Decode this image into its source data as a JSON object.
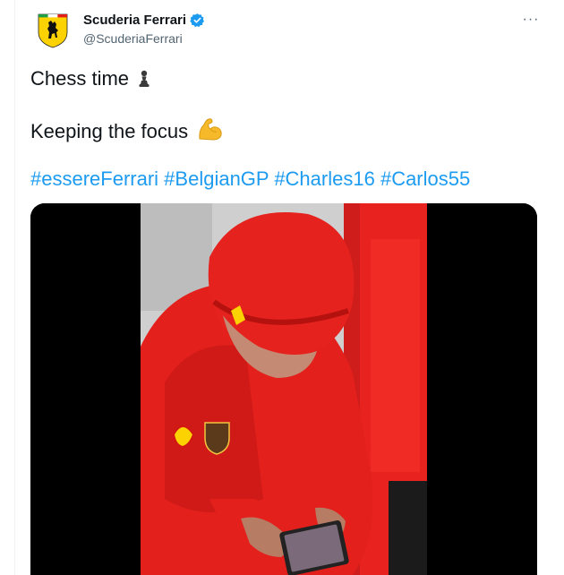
{
  "account": {
    "display_name": "Scuderia Ferrari",
    "handle": "@ScuderiaFerrari",
    "verified": true,
    "avatar_icon": "ferrari-shield-logo"
  },
  "menu": {
    "more_label": "···"
  },
  "tweet": {
    "line1": "Chess time",
    "line1_emoji": "chess-pawn",
    "line2": "Keeping the focus",
    "line2_emoji": "flexed-biceps",
    "hashtags": [
      "#essereFerrari",
      "#BelgianGP",
      "#Charles16",
      "#Carlos55"
    ]
  },
  "media": {
    "type": "video",
    "description_icon": "video-thumbnail"
  },
  "colors": {
    "link": "#1d9bf0",
    "text": "#0f1419",
    "secondary": "#536471",
    "ferrari_red": "#e31d1a",
    "ferrari_yellow": "#fdd202",
    "verified": "#1d9bf0"
  }
}
